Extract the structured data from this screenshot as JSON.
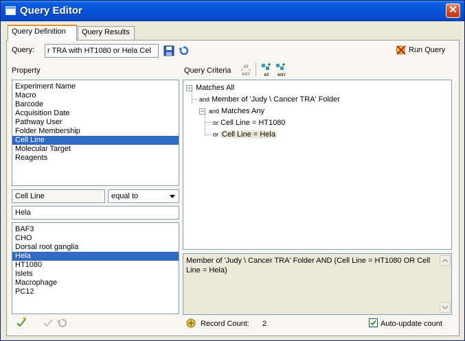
{
  "window": {
    "title": "Query Editor",
    "close_glyph": "✕"
  },
  "tabs": [
    {
      "label": "Query Definition",
      "active": true
    },
    {
      "label": "Query Results",
      "active": false
    }
  ],
  "query": {
    "label": "Query:",
    "value": "r TRA with HT1080 or Hela Cel",
    "run_label": "Run Query"
  },
  "property": {
    "header": "Property",
    "items": [
      "Experiment Name",
      "Macro",
      "Barcode",
      "Acquisition Date",
      "Pathway User",
      "Folder Membership",
      "Cell Line",
      "Molecular Target",
      "Reagents"
    ],
    "selected": "Cell Line"
  },
  "condition": {
    "field": "Cell Line",
    "operator": "equal to",
    "value": "Hela"
  },
  "values": {
    "items": [
      "BAF3",
      "CHO",
      "Dorsal root ganglia",
      "Hela",
      "HT1080",
      "Islets",
      "Macrophage",
      "PC12"
    ],
    "selected": "Hela"
  },
  "criteria": {
    "header": "Query Criteria",
    "all_any_icon_text": [
      "All",
      "ANY"
    ],
    "add_all_text": "All",
    "add_any_text": "ANY",
    "tree": {
      "root": "Matches All",
      "and_conj": "and",
      "or_conj": "or",
      "member": "Member of 'Judy \\ Cancer TRA' Folder",
      "any_group": "Matches Any",
      "or1": "Cell Line = HT1080",
      "or2": "Cell Line = Hela"
    },
    "summary": "Member of 'Judy \\ Cancer TRA' Folder AND (Cell Line = HT1080 OR Cell Line = Hela)"
  },
  "footer": {
    "record_label": "Record Count:",
    "record_count": "2",
    "auto_update_label": "Auto-update count",
    "auto_update_checked": true
  },
  "colors": {
    "titlebar": "#0752d7",
    "selection": "#316ac5",
    "tab_highlight": "#e68b2c",
    "close": "#d4431e"
  }
}
